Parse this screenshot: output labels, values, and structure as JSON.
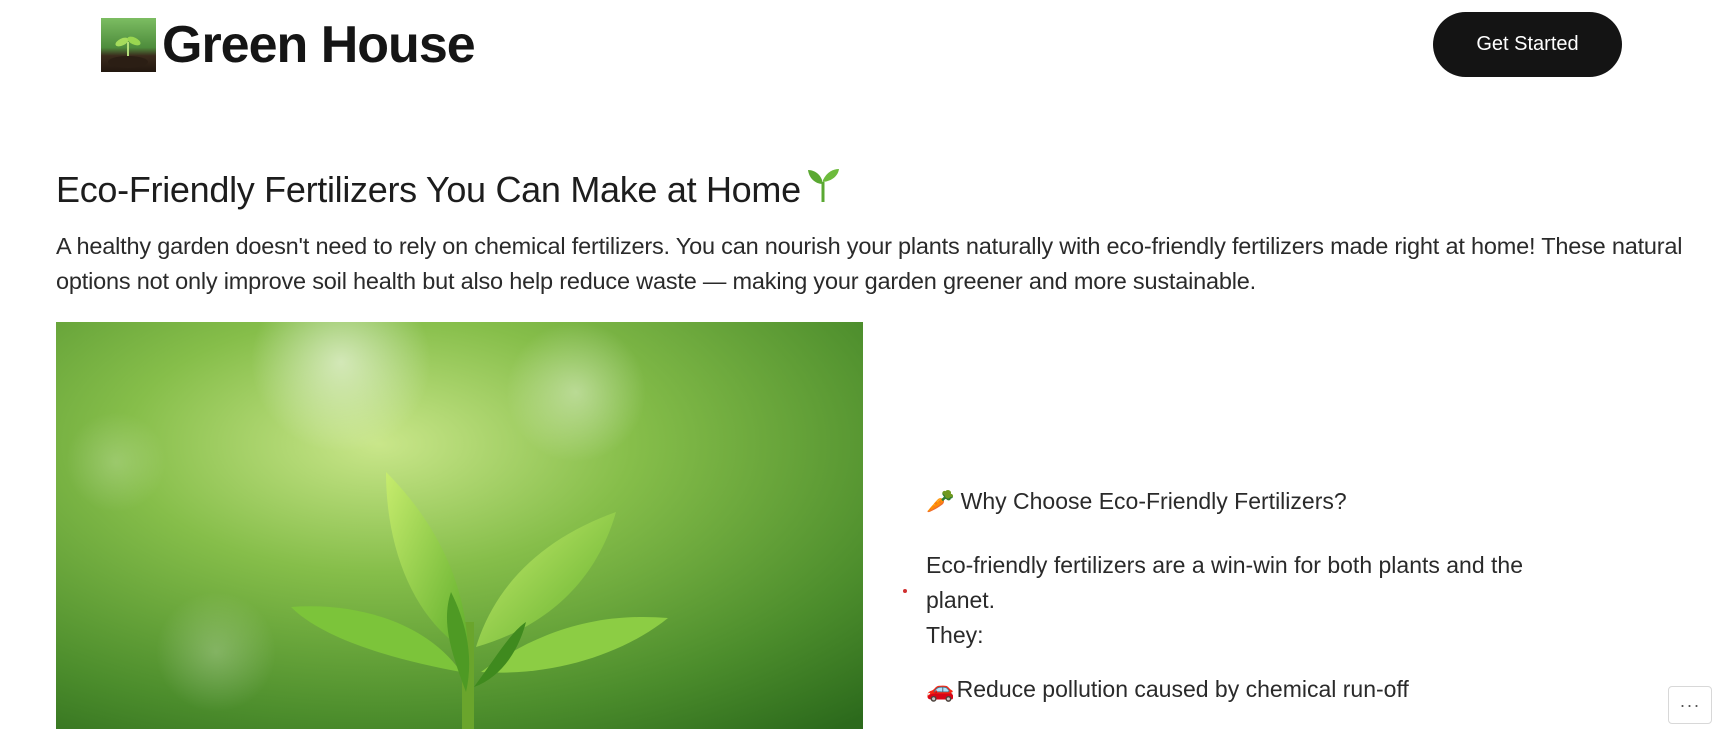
{
  "header": {
    "brand_name": "Green House",
    "cta_label": "Get Started"
  },
  "article": {
    "title": "Eco-Friendly Fertilizers You Can Make at Home",
    "title_emoji": "🌱",
    "intro": "A healthy garden doesn't need to rely on chemical fertilizers. You can nourish your plants naturally with eco-friendly fertilizers made right at home! These natural options not only improve soil health but also help reduce waste — making your garden greener and more sustainable."
  },
  "side": {
    "heading_emoji": "🥕",
    "heading": "Why Choose Eco-Friendly Fertilizers?",
    "paragraph_line1": "Eco-friendly fertilizers are a win-win for both plants and the planet.",
    "paragraph_line2": "They:",
    "item_emoji": "🚗",
    "item_text": "Reduce pollution caused by chemical run-off"
  },
  "misc": {
    "more_label": "···"
  },
  "colors": {
    "cta_bg": "#141414",
    "text": "#1a1a1a",
    "accent_green": "#5aa832"
  }
}
